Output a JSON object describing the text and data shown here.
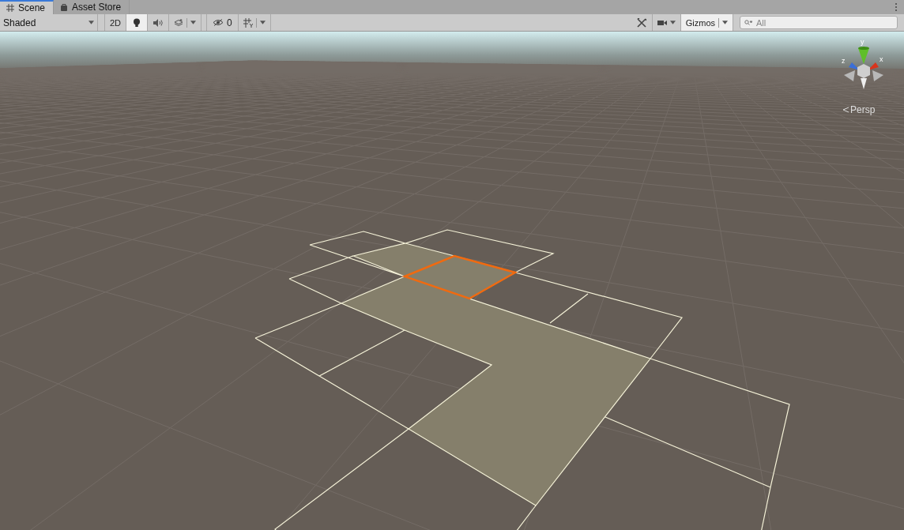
{
  "tabs": [
    {
      "label": "Scene",
      "selected": true
    },
    {
      "label": "Asset Store",
      "selected": false
    }
  ],
  "toolbar": {
    "shading_mode": "Shaded",
    "mode_2d": {
      "label": "2D",
      "on": false
    },
    "lighting_on": true,
    "audio_on": false,
    "hidden_count": "0",
    "gizmos": {
      "label": "Gizmos",
      "on": true
    },
    "search": {
      "placeholder": "All"
    }
  },
  "orientation_gizmo": {
    "axes": [
      "y",
      "z",
      "x"
    ],
    "projection": "Persp"
  }
}
